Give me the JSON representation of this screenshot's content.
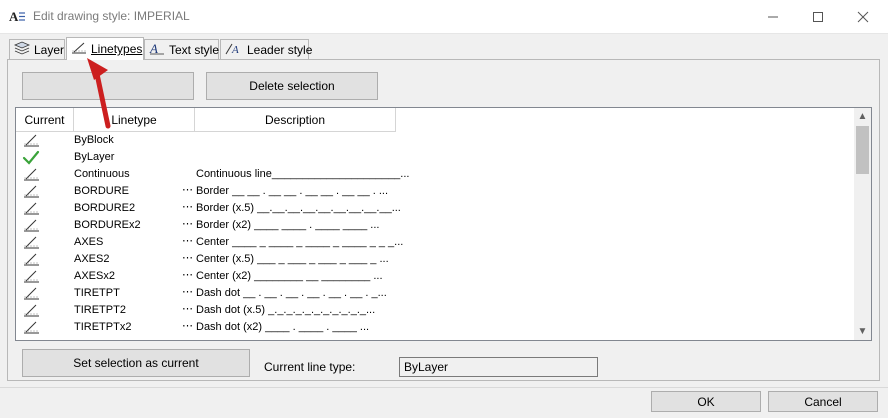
{
  "window": {
    "title": "Edit drawing style: IMPERIAL",
    "app_icon": "text-style-icon",
    "controls": [
      "minimize-icon",
      "maximize-icon",
      "close-icon"
    ]
  },
  "tabs": [
    {
      "label": "Layer",
      "icon": "layers-icon",
      "active": false
    },
    {
      "label": "Linetypes",
      "icon": "linetype-icon",
      "active": true
    },
    {
      "label": "Text style",
      "icon": "text-style-icon",
      "active": false
    },
    {
      "label": "Leader style",
      "icon": "leader-style-icon",
      "active": false
    }
  ],
  "toolbar": {
    "load_label": "",
    "delete_label": "Delete selection"
  },
  "table": {
    "columns": [
      "Current",
      "Linetype",
      "Description"
    ],
    "rows": [
      {
        "name": "ByBlock",
        "desc": "",
        "icon": "linetype-icon",
        "current": false
      },
      {
        "name": "ByLayer",
        "desc": "",
        "icon": "checkmark-icon",
        "current": true
      },
      {
        "name": "Continuous",
        "desc": "Continuous line_____________________...",
        "icon": "linetype-icon",
        "current": false
      },
      {
        "name": "BORDURE",
        "desc": "Border __ __ . __ __ . __ __ . __ __ . ...",
        "icon": "linetype-icon",
        "current": false
      },
      {
        "name": "BORDURE2",
        "desc": "Border (x.5) __.__.__.__.__.__.__.__.__...",
        "icon": "linetype-icon",
        "current": false
      },
      {
        "name": "BORDUREx2",
        "desc": "Border (x2) ____ ____ .  ____ ____ ...",
        "icon": "linetype-icon",
        "current": false
      },
      {
        "name": "AXES",
        "desc": "Center ____ _ ____ _ ____ _ ____ _ _ _...",
        "icon": "linetype-icon",
        "current": false
      },
      {
        "name": "AXES2",
        "desc": "Center (x.5) ___ _ ___ _ ___ _ ___ _ ...",
        "icon": "linetype-icon",
        "current": false
      },
      {
        "name": "AXESx2",
        "desc": "Center (x2) ________  __  ________  ...",
        "icon": "linetype-icon",
        "current": false
      },
      {
        "name": "TIRETPT",
        "desc": "Dash dot __ . __ . __ . __ . __ . __ . _...",
        "icon": "linetype-icon",
        "current": false
      },
      {
        "name": "TIRETPT2",
        "desc": "Dash dot (x.5) _._._._._._._._._._._...",
        "icon": "linetype-icon",
        "current": false
      },
      {
        "name": "TIRETPTx2",
        "desc": "Dash dot (x2) ____  .  ____  .  ____ ...",
        "icon": "linetype-icon",
        "current": false
      }
    ]
  },
  "footer": {
    "set_current_label": "Set selection as current",
    "current_label": "Current line type:",
    "current_value": "ByLayer"
  },
  "dialog": {
    "ok_label": "OK",
    "cancel_label": "Cancel"
  },
  "colors": {
    "annotation_arrow": "#cc1f1f",
    "check": "#3aa33a",
    "window_bg": "#f0f0f0"
  },
  "annotation": {
    "type": "red-arrow-pointing-to-linetypes-tab"
  }
}
